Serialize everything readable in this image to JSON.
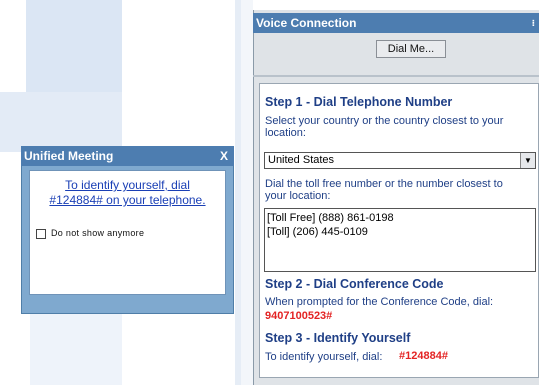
{
  "unified_meeting": {
    "title": "Unified Meeting",
    "close_label": "X",
    "link_line1": "To identify yourself, dial",
    "link_line2": "#124884# on your telephone.",
    "checkbox_label": "Do not show anymore"
  },
  "voice_connection": {
    "title": "Voice Connection",
    "dial_me_label": "Dial Me...",
    "step1": {
      "heading": "Step 1 - Dial Telephone Number",
      "instruction_line1": "Select your country or the country closest to your",
      "instruction_line2": "location:",
      "country_selected": "United States",
      "dial_instruction_line1": "Dial the toll free number or the number closest to",
      "dial_instruction_line2": "your location:",
      "numbers": [
        "[Toll Free] (888) 861-0198",
        "[Toll] (206) 445-0109"
      ]
    },
    "step2": {
      "heading": "Step 2 - Dial Conference Code",
      "instruction": "When prompted for the Conference Code, dial:",
      "code": "9407100523#"
    },
    "step3": {
      "heading": "Step 3 - Identify Yourself",
      "instruction": "To identify yourself, dial:",
      "code": "#124884#"
    }
  },
  "colors": {
    "titlebar": "#4d7db0",
    "heading_text": "#1f3f86",
    "code_red": "#e32323",
    "link_blue": "#1a3fb5"
  }
}
